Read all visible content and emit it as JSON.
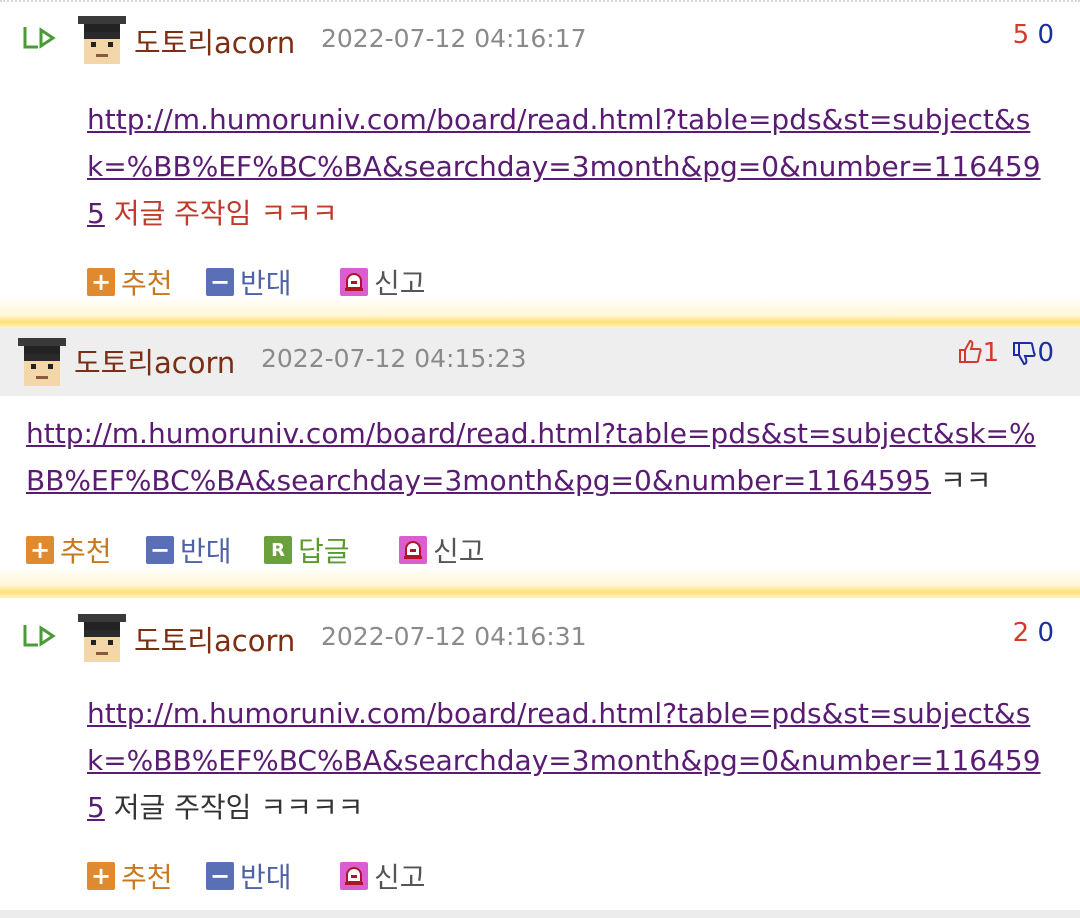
{
  "comments": [
    {
      "author": "도토리acorn",
      "date": "2022-07-12 04:16:17",
      "votes_up": "5",
      "votes_down": "0",
      "link": "http://m.humoruniv.com/board/read.html?table=pds&st=subject&sk=%BB%EF%BC%BA&searchday=3month&pg=0&number=1164595",
      "text": " 저글 주작임 ㅋㅋㅋ",
      "actions": {
        "up": "추천",
        "down": "반대",
        "report": "신고"
      }
    },
    {
      "author": "도토리acorn",
      "date": "2022-07-12 04:15:23",
      "votes_up": "1",
      "votes_down": "0",
      "link": "http://m.humoruniv.com/board/read.html?table=pds&st=subject&sk=%BB%EF%BC%BA&searchday=3month&pg=0&number=1164595",
      "text": " ㅋㅋ",
      "actions": {
        "up": "추천",
        "down": "반대",
        "reply": "답글",
        "report": "신고"
      }
    },
    {
      "author": "도토리acorn",
      "date": "2022-07-12 04:16:31",
      "votes_up": "2",
      "votes_down": "0",
      "link": "http://m.humoruniv.com/board/read.html?table=pds&st=subject&sk=%BB%EF%BC%BA&searchday=3month&pg=0&number=1164595",
      "text": " 저글 주작임 ㅋㅋㅋㅋ",
      "actions": {
        "up": "추천",
        "down": "반대",
        "report": "신고"
      }
    }
  ],
  "icons": {
    "reply_arrow": "reply-arrow-icon",
    "avatar": "graduate-avatar",
    "thumb_up": "thumbs-up-icon",
    "thumb_down": "thumbs-down-icon",
    "up": "plus-icon",
    "down": "minus-icon",
    "reply": "r-icon",
    "report": "siren-icon"
  },
  "colors": {
    "author": "#7a2f12",
    "link": "#5a1c73",
    "up": "#d23b2b",
    "down": "#1a2ea0",
    "highlight_text": "#c0392b"
  }
}
